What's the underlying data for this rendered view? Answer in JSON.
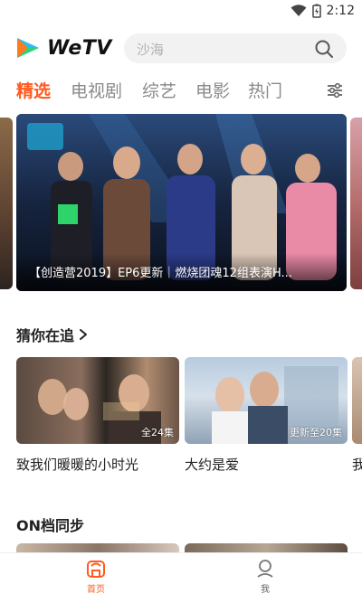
{
  "status_bar": {
    "time": "2:12"
  },
  "header": {
    "logo_text": "WeTV",
    "search_placeholder": "沙海"
  },
  "tabs": [
    {
      "label": "精选",
      "active": true
    },
    {
      "label": "电视剧",
      "active": false
    },
    {
      "label": "综艺",
      "active": false
    },
    {
      "label": "电影",
      "active": false
    },
    {
      "label": "热门",
      "active": false
    }
  ],
  "banner": {
    "caption": "【创造营2019】EP6更新｜燃烧团魂12组表演H..."
  },
  "sections": {
    "continue_watching": {
      "title": "猜你在追",
      "items": [
        {
          "title": "致我们暖暖的小时光",
          "badge": "全24集"
        },
        {
          "title": "大约是爱",
          "badge": "更新至20集"
        },
        {
          "title": "我"
        }
      ]
    },
    "on_schedule": {
      "title": "ON档同步"
    }
  },
  "bottom_nav": [
    {
      "label": "首页",
      "icon": "home-icon",
      "active": true
    },
    {
      "label": "我",
      "icon": "profile-icon",
      "active": false
    }
  ],
  "colors": {
    "accent": "#ff5a1f",
    "inactive_tab": "#8a8a8a"
  }
}
